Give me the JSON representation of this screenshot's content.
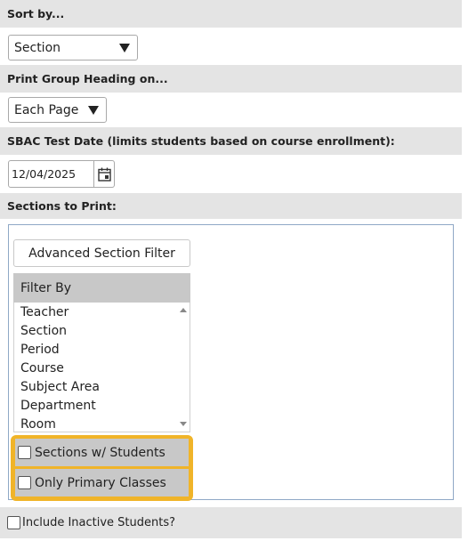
{
  "sort": {
    "heading": "Sort by...",
    "selected": "Section"
  },
  "group_heading": {
    "heading": "Print Group Heading on...",
    "selected": "Each Page"
  },
  "test_date": {
    "heading": "SBAC Test Date (limits students based on course enrollment):",
    "value": "12/04/2025",
    "icon": "calendar-icon"
  },
  "sections": {
    "heading": "Sections to Print:",
    "advanced_filter_label": "Advanced Section Filter",
    "filter_by_label": "Filter By",
    "filter_options": [
      "Teacher",
      "Section",
      "Period",
      "Course",
      "Subject Area",
      "Department",
      "Room"
    ],
    "sections_with_students": {
      "label": "Sections w/ Students",
      "checked": false
    },
    "only_primary": {
      "label": "Only Primary Classes",
      "checked": false
    },
    "highlight_color": "#f0b429"
  },
  "include_inactive": {
    "label": "Include Inactive Students?",
    "checked": false
  }
}
